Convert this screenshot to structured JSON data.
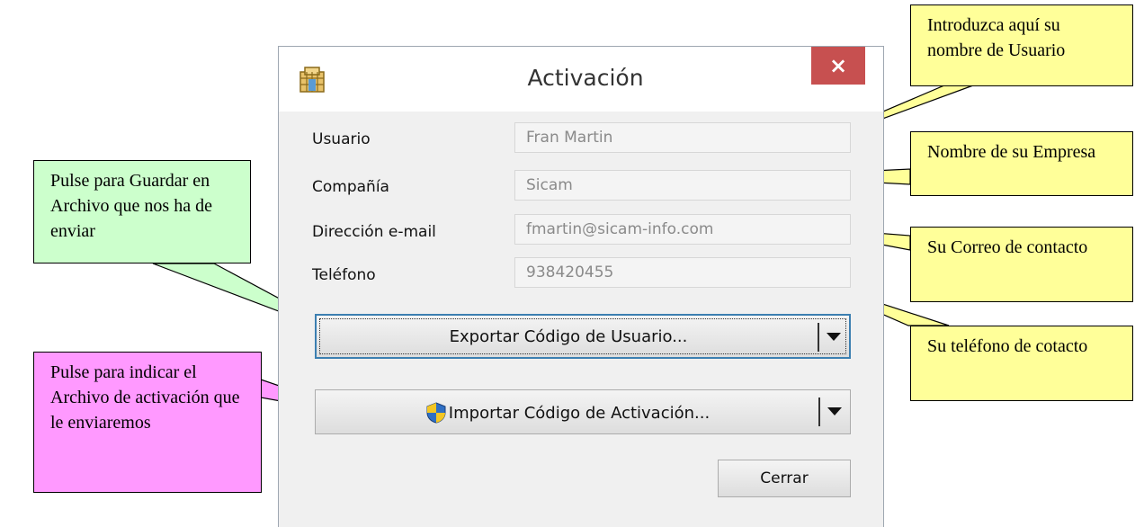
{
  "window": {
    "title": "Activación",
    "close_glyph": "×"
  },
  "fields": [
    {
      "label": "Usuario",
      "value": "Fran Martin"
    },
    {
      "label": "Compañía",
      "value": "Sicam"
    },
    {
      "label": "Dirección e-mail",
      "value": "fmartin@sicam-info.com"
    },
    {
      "label": "Teléfono",
      "value": "938420455"
    }
  ],
  "buttons": {
    "export_label": "Exportar Código de Usuario...",
    "import_label": "Importar Código de Activación...",
    "close_label": "Cerrar"
  },
  "callouts": {
    "usuario": "Introduzca aquí su nombre de Usuario",
    "empresa": "Nombre de su Empresa",
    "correo": "Su Correo de contacto",
    "telefono": "Su teléfono de cotacto",
    "guardar": "Pulse para Guardar en Archivo que nos ha de enviar",
    "importar": "Pulse para indicar el Archivo de activación que le enviaremos"
  },
  "icons": {
    "app": "app-grid-icon",
    "close": "close-icon",
    "shield": "uac-shield-icon",
    "dropdown": "chevron-down-icon"
  },
  "colors": {
    "callout_yellow": "#ffff99",
    "callout_green": "#ccffcc",
    "callout_pink": "#ff99ff",
    "close_red": "#c75050",
    "focus_blue": "#3c7fb1"
  }
}
